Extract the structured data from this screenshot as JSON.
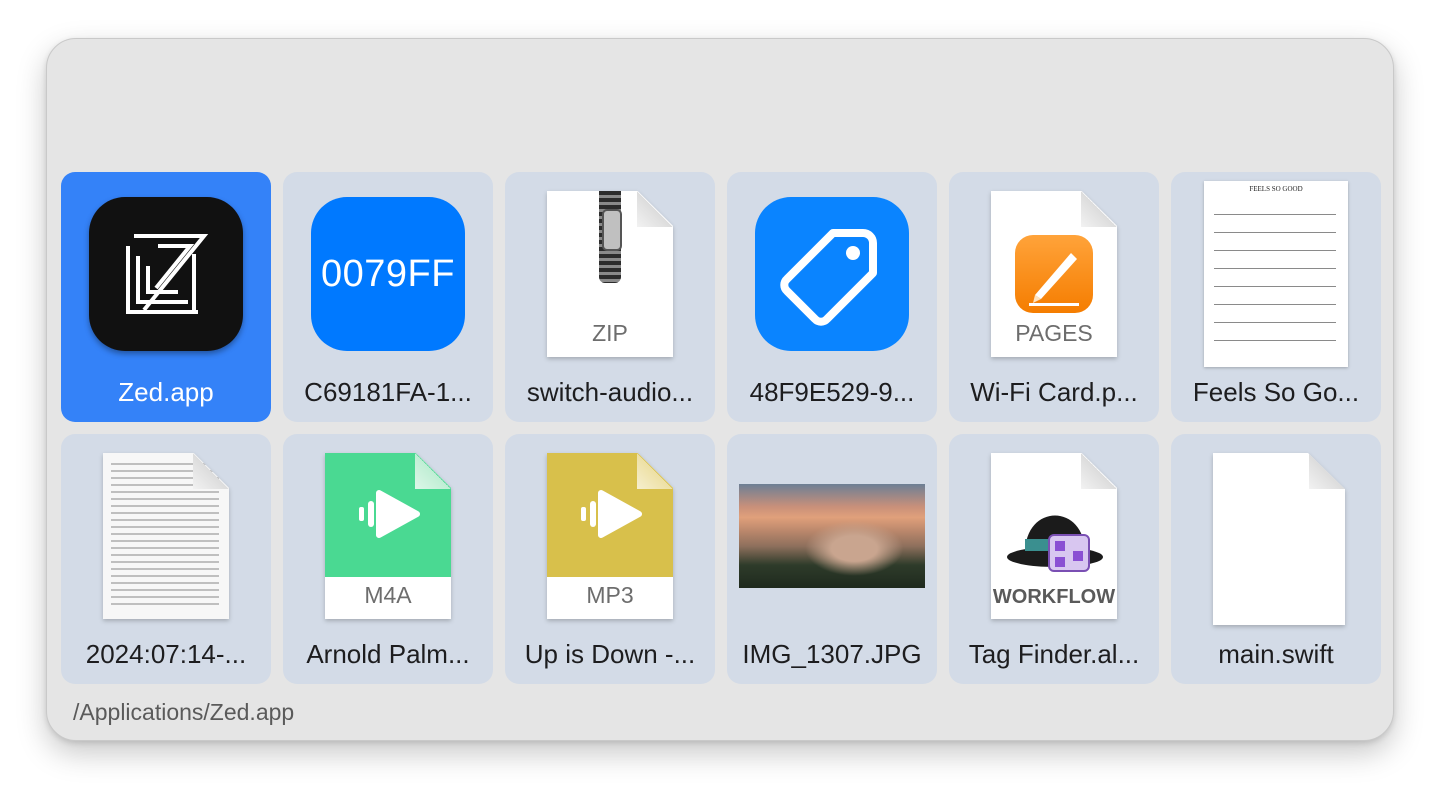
{
  "tiles": [
    {
      "label": "Zed.app"
    },
    {
      "label": "C69181FA-1...",
      "icon_text": "0079FF"
    },
    {
      "label": "switch-audio...",
      "type_text": "ZIP"
    },
    {
      "label": "48F9E529-9..."
    },
    {
      "label": "Wi-Fi Card.p...",
      "type_text": "PAGES"
    },
    {
      "label": "Feels So Go...",
      "sheet_title": "FEELS SO GOOD"
    },
    {
      "label": "2024:07:14-..."
    },
    {
      "label": "Arnold Palm...",
      "type_text": "M4A"
    },
    {
      "label": "Up is Down -...",
      "type_text": "MP3"
    },
    {
      "label": "IMG_1307.JPG"
    },
    {
      "label": "Tag Finder.al...",
      "type_text": "WORKFLOW"
    },
    {
      "label": "main.swift"
    }
  ],
  "footer": {
    "path": "/Applications/Zed.app"
  },
  "colors": {
    "selection": "#3482f8",
    "tile": "#d3dbe7",
    "color_swatch": "#0079ff",
    "tag_app": "#0a84ff"
  }
}
